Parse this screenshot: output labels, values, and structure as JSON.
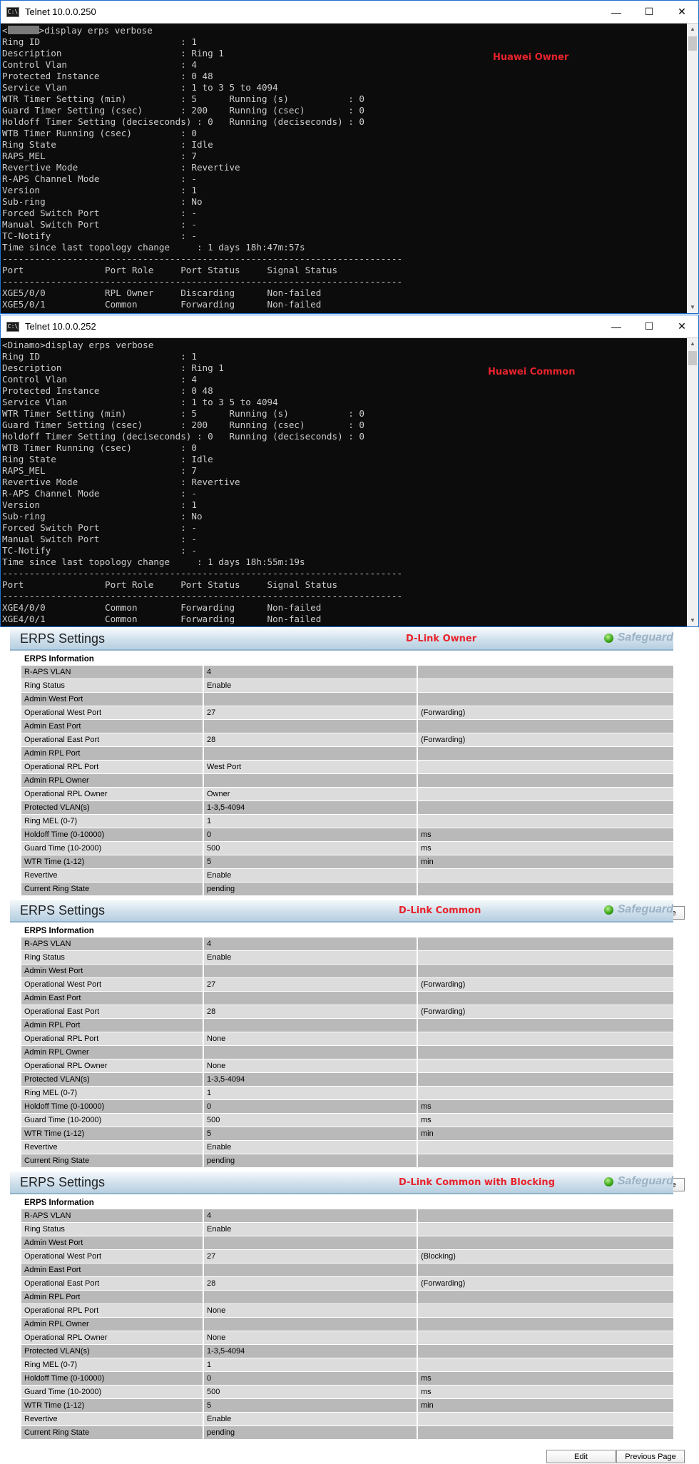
{
  "terminal1": {
    "title": "Telnet 10.0.0.250",
    "icon": "cmd-icon",
    "label": "Huawei Owner",
    "prompt_prefix": "<",
    "prompt_suffix": ">display erps verbose",
    "lines": [
      "Ring ID                          : 1",
      "Description                      : Ring 1",
      "Control Vlan                     : 4",
      "Protected Instance               : 0 48",
      "Service Vlan                     : 1 to 3 5 to 4094",
      "WTR Timer Setting (min)          : 5      Running (s)           : 0",
      "Guard Timer Setting (csec)       : 200    Running (csec)        : 0",
      "Holdoff Timer Setting (deciseconds) : 0   Running (deciseconds) : 0",
      "WTB Timer Running (csec)         : 0",
      "Ring State                       : Idle",
      "RAPS_MEL                         : 7",
      "Revertive Mode                   : Revertive",
      "R-APS Channel Mode               : -",
      "Version                          : 1",
      "Sub-ring                         : No",
      "Forced Switch Port               : -",
      "Manual Switch Port               : -",
      "TC-Notify                        : -",
      "Time since last topology change     : 1 days 18h:47m:57s",
      "--------------------------------------------------------------------------",
      "Port               Port Role     Port Status     Signal Status",
      "--------------------------------------------------------------------------",
      "XGE5/0/0           RPL Owner     Discarding      Non-failed",
      "XGE5/0/1           Common        Forwarding      Non-failed"
    ]
  },
  "terminal2": {
    "title": "Telnet 10.0.0.252",
    "icon": "cmd-icon",
    "label": "Huawei Common",
    "prompt": "<Dinamo>display erps verbose",
    "lines": [
      "Ring ID                          : 1",
      "Description                      : Ring 1",
      "Control Vlan                     : 4",
      "Protected Instance               : 0 48",
      "Service Vlan                     : 1 to 3 5 to 4094",
      "WTR Timer Setting (min)          : 5      Running (s)           : 0",
      "Guard Timer Setting (csec)       : 200    Running (csec)        : 0",
      "Holdoff Timer Setting (deciseconds) : 0   Running (deciseconds) : 0",
      "WTB Timer Running (csec)         : 0",
      "Ring State                       : Idle",
      "RAPS_MEL                         : 7",
      "Revertive Mode                   : Revertive",
      "R-APS Channel Mode               : -",
      "Version                          : 1",
      "Sub-ring                         : No",
      "Forced Switch Port               : -",
      "Manual Switch Port               : -",
      "TC-Notify                        : -",
      "Time since last topology change     : 1 days 18h:55m:19s",
      "--------------------------------------------------------------------------",
      "Port               Port Role     Port Status     Signal Status",
      "--------------------------------------------------------------------------",
      "XGE4/0/0           Common        Forwarding      Non-failed",
      "XGE4/0/1           Common        Forwarding      Non-failed"
    ]
  },
  "window_buttons": {
    "minimize": "—",
    "maximize": "☐",
    "close": "✕"
  },
  "dlink_common": {
    "title": "ERPS Settings",
    "brand": "Safeguard",
    "caption": "ERPS Information",
    "edit_label": "Edit",
    "previous_label": "Previous Page"
  },
  "panels": [
    {
      "label": "D-Link Owner",
      "rows": [
        [
          "R-APS VLAN",
          "4",
          ""
        ],
        [
          "Ring Status",
          "Enable",
          ""
        ],
        [
          "Admin West Port",
          "",
          ""
        ],
        [
          "Operational West Port",
          "27",
          "(Forwarding)"
        ],
        [
          "Admin East Port",
          "",
          ""
        ],
        [
          "Operational East Port",
          "28",
          "(Forwarding)"
        ],
        [
          "Admin RPL Port",
          "",
          ""
        ],
        [
          "Operational RPL Port",
          "West Port",
          ""
        ],
        [
          "Admin RPL Owner",
          "",
          ""
        ],
        [
          "Operational RPL Owner",
          "Owner",
          ""
        ],
        [
          "Protected VLAN(s)",
          "1-3,5-4094",
          ""
        ],
        [
          "Ring MEL (0-7)",
          "1",
          ""
        ],
        [
          "Holdoff Time (0-10000)",
          "0",
          "ms"
        ],
        [
          "Guard Time (10-2000)",
          "500",
          "ms"
        ],
        [
          "WTR Time (1-12)",
          "5",
          "min"
        ],
        [
          "Revertive",
          "Enable",
          ""
        ],
        [
          "Current Ring State",
          "pending",
          ""
        ]
      ]
    },
    {
      "label": "D-Link Common",
      "rows": [
        [
          "R-APS VLAN",
          "4",
          ""
        ],
        [
          "Ring Status",
          "Enable",
          ""
        ],
        [
          "Admin West Port",
          "",
          ""
        ],
        [
          "Operational West Port",
          "27",
          "(Forwarding)"
        ],
        [
          "Admin East Port",
          "",
          ""
        ],
        [
          "Operational East Port",
          "28",
          "(Forwarding)"
        ],
        [
          "Admin RPL Port",
          "",
          ""
        ],
        [
          "Operational RPL Port",
          "None",
          ""
        ],
        [
          "Admin RPL Owner",
          "",
          ""
        ],
        [
          "Operational RPL Owner",
          "None",
          ""
        ],
        [
          "Protected VLAN(s)",
          "1-3,5-4094",
          ""
        ],
        [
          "Ring MEL (0-7)",
          "1",
          ""
        ],
        [
          "Holdoff Time (0-10000)",
          "0",
          "ms"
        ],
        [
          "Guard Time (10-2000)",
          "500",
          "ms"
        ],
        [
          "WTR Time (1-12)",
          "5",
          "min"
        ],
        [
          "Revertive",
          "Enable",
          ""
        ],
        [
          "Current Ring State",
          "pending",
          ""
        ]
      ]
    },
    {
      "label": "D-Link Common with Blocking",
      "rows": [
        [
          "R-APS VLAN",
          "4",
          ""
        ],
        [
          "Ring Status",
          "Enable",
          ""
        ],
        [
          "Admin West Port",
          "",
          ""
        ],
        [
          "Operational West Port",
          "27",
          "(Blocking)"
        ],
        [
          "Admin East Port",
          "",
          ""
        ],
        [
          "Operational East Port",
          "28",
          "(Forwarding)"
        ],
        [
          "Admin RPL Port",
          "",
          ""
        ],
        [
          "Operational RPL Port",
          "None",
          ""
        ],
        [
          "Admin RPL Owner",
          "",
          ""
        ],
        [
          "Operational RPL Owner",
          "None",
          ""
        ],
        [
          "Protected VLAN(s)",
          "1-3,5-4094",
          ""
        ],
        [
          "Ring MEL (0-7)",
          "1",
          ""
        ],
        [
          "Holdoff Time (0-10000)",
          "0",
          "ms"
        ],
        [
          "Guard Time (10-2000)",
          "500",
          "ms"
        ],
        [
          "WTR Time (1-12)",
          "5",
          "min"
        ],
        [
          "Revertive",
          "Enable",
          ""
        ],
        [
          "Current Ring State",
          "pending",
          ""
        ]
      ]
    }
  ]
}
